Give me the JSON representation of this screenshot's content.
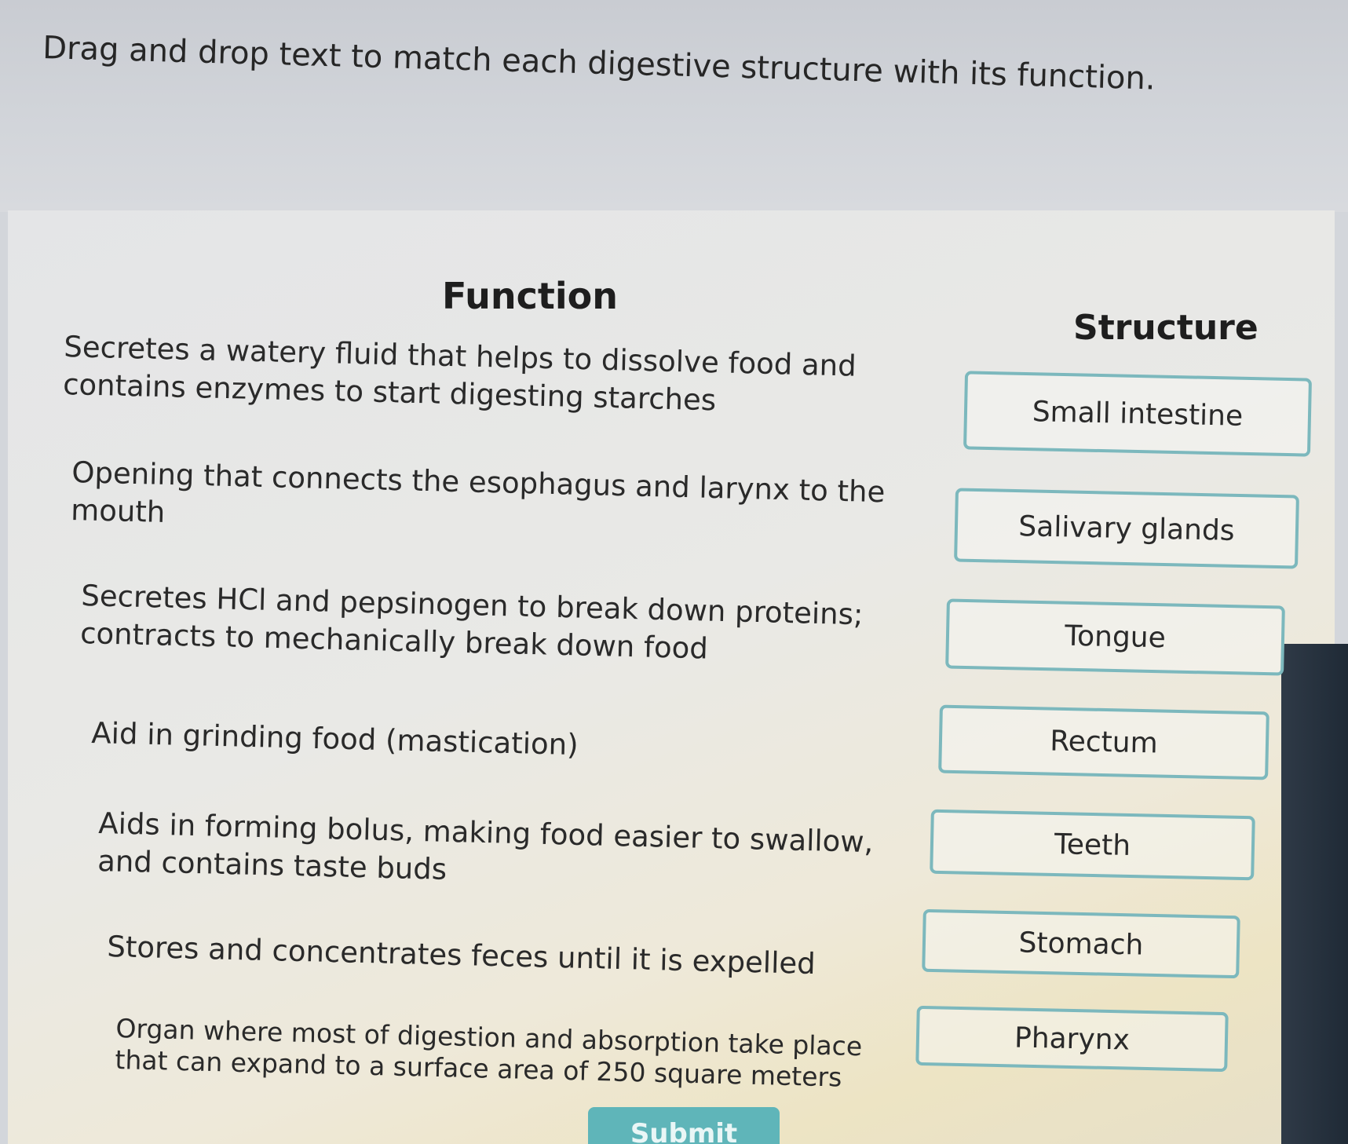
{
  "instruction": "Drag and drop text to match each digestive structure with its function.",
  "headings": {
    "function": "Function",
    "structure": "Structure"
  },
  "functions": [
    {
      "text": "Secretes a watery fluid that helps to dissolve food and contains enzymes to start digesting starches"
    },
    {
      "text": "Opening that connects the esophagus and larynx to the mouth"
    },
    {
      "text": "Secretes HCl and pepsinogen to break down proteins; contracts to mechanically break down food"
    },
    {
      "text": "Aid in grinding food (mastication)"
    },
    {
      "text": "Aids in forming bolus, making food easier to swallow, and contains taste buds"
    },
    {
      "text": "Stores and concentrates feces until it is expelled"
    },
    {
      "text": "Organ where most of digestion and absorption take place that can expand to a surface area of 250 square meters"
    }
  ],
  "structures": [
    {
      "label": "Small intestine"
    },
    {
      "label": "Salivary glands"
    },
    {
      "label": "Tongue"
    },
    {
      "label": "Rectum"
    },
    {
      "label": "Teeth"
    },
    {
      "label": "Stomach"
    },
    {
      "label": "Pharynx"
    }
  ],
  "submit_label": "Submit",
  "colors": {
    "box_border": "#7cb8bd",
    "submit_bg": "#5fb5b9"
  }
}
